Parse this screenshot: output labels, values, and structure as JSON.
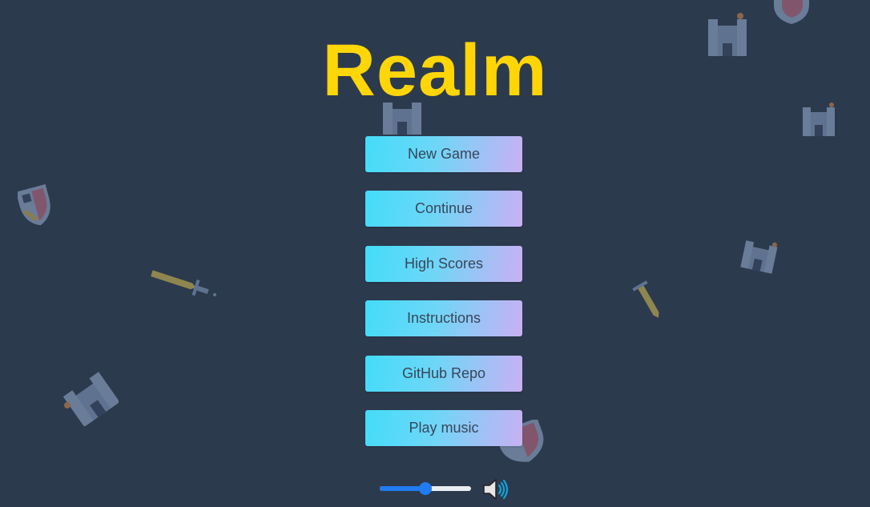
{
  "game": {
    "title": "Realm"
  },
  "menu": {
    "new_game": "New Game",
    "continue": "Continue",
    "high_scores": "High Scores",
    "instructions": "Instructions",
    "github_repo": "GitHub Repo",
    "play_music": "Play music"
  },
  "volume": {
    "level": 0.5,
    "icon": "speaker-icon"
  },
  "colors": {
    "background": "#2c3a4d",
    "title": "#ffd400",
    "button_start": "#43dcf9",
    "button_end": "#c9b0f3",
    "slider": "#1f7cf2"
  }
}
